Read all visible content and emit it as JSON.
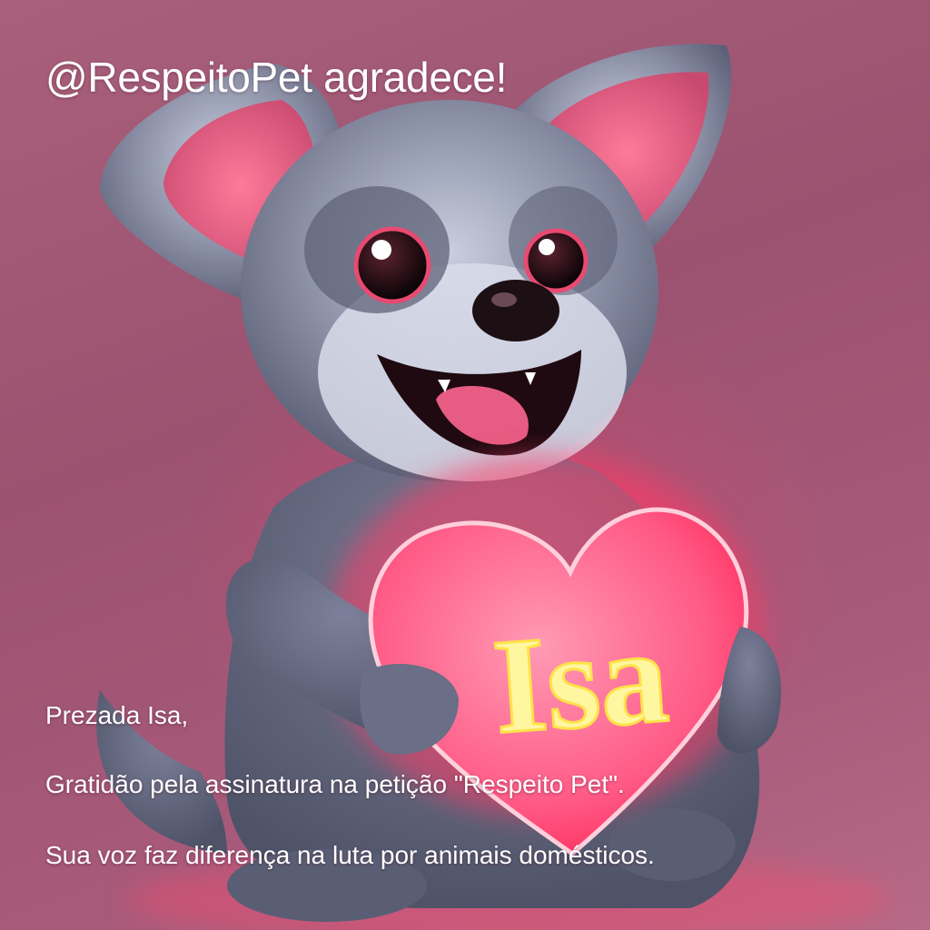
{
  "headline": "@RespeitoPet agradece!",
  "heart_name": "Isa",
  "message": {
    "greeting": "Prezada Isa,",
    "thanks": "Gratidão pela assinatura na petição \"Respeito Pet\".",
    "closing": "Sua voz faz diferença na luta por animais domésticos."
  },
  "colors": {
    "background": "#a05a78",
    "fur": "#6e7288",
    "heart": "#ff5a8a",
    "heart_text": "#fff6a0"
  }
}
